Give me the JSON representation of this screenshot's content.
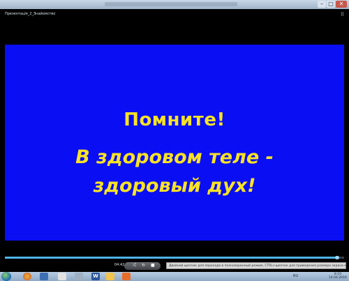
{
  "window": {
    "min_icon": "minimize-icon",
    "max_icon": "maximize-icon",
    "close_icon": "close-icon",
    "close_glyph": "✕"
  },
  "player": {
    "file_title": "Презентація_2_Знайомство",
    "slide": {
      "title": "Помните!",
      "line1": "В здоровом теле -",
      "line2": "здоровый дух!",
      "background": "#0a0ef2",
      "text_color": "#f7e225"
    },
    "progress": 0.98,
    "time": "04:42",
    "hint_text": "Двойной щелчок для перехода в полноэкранный режим, CTRL+щелчок для приведения размера экрана к размеру 4:3..."
  },
  "taskbar": {
    "word_label": "W",
    "lang": "RU",
    "clock_time": "8:19",
    "clock_date": "14.04.2016"
  }
}
